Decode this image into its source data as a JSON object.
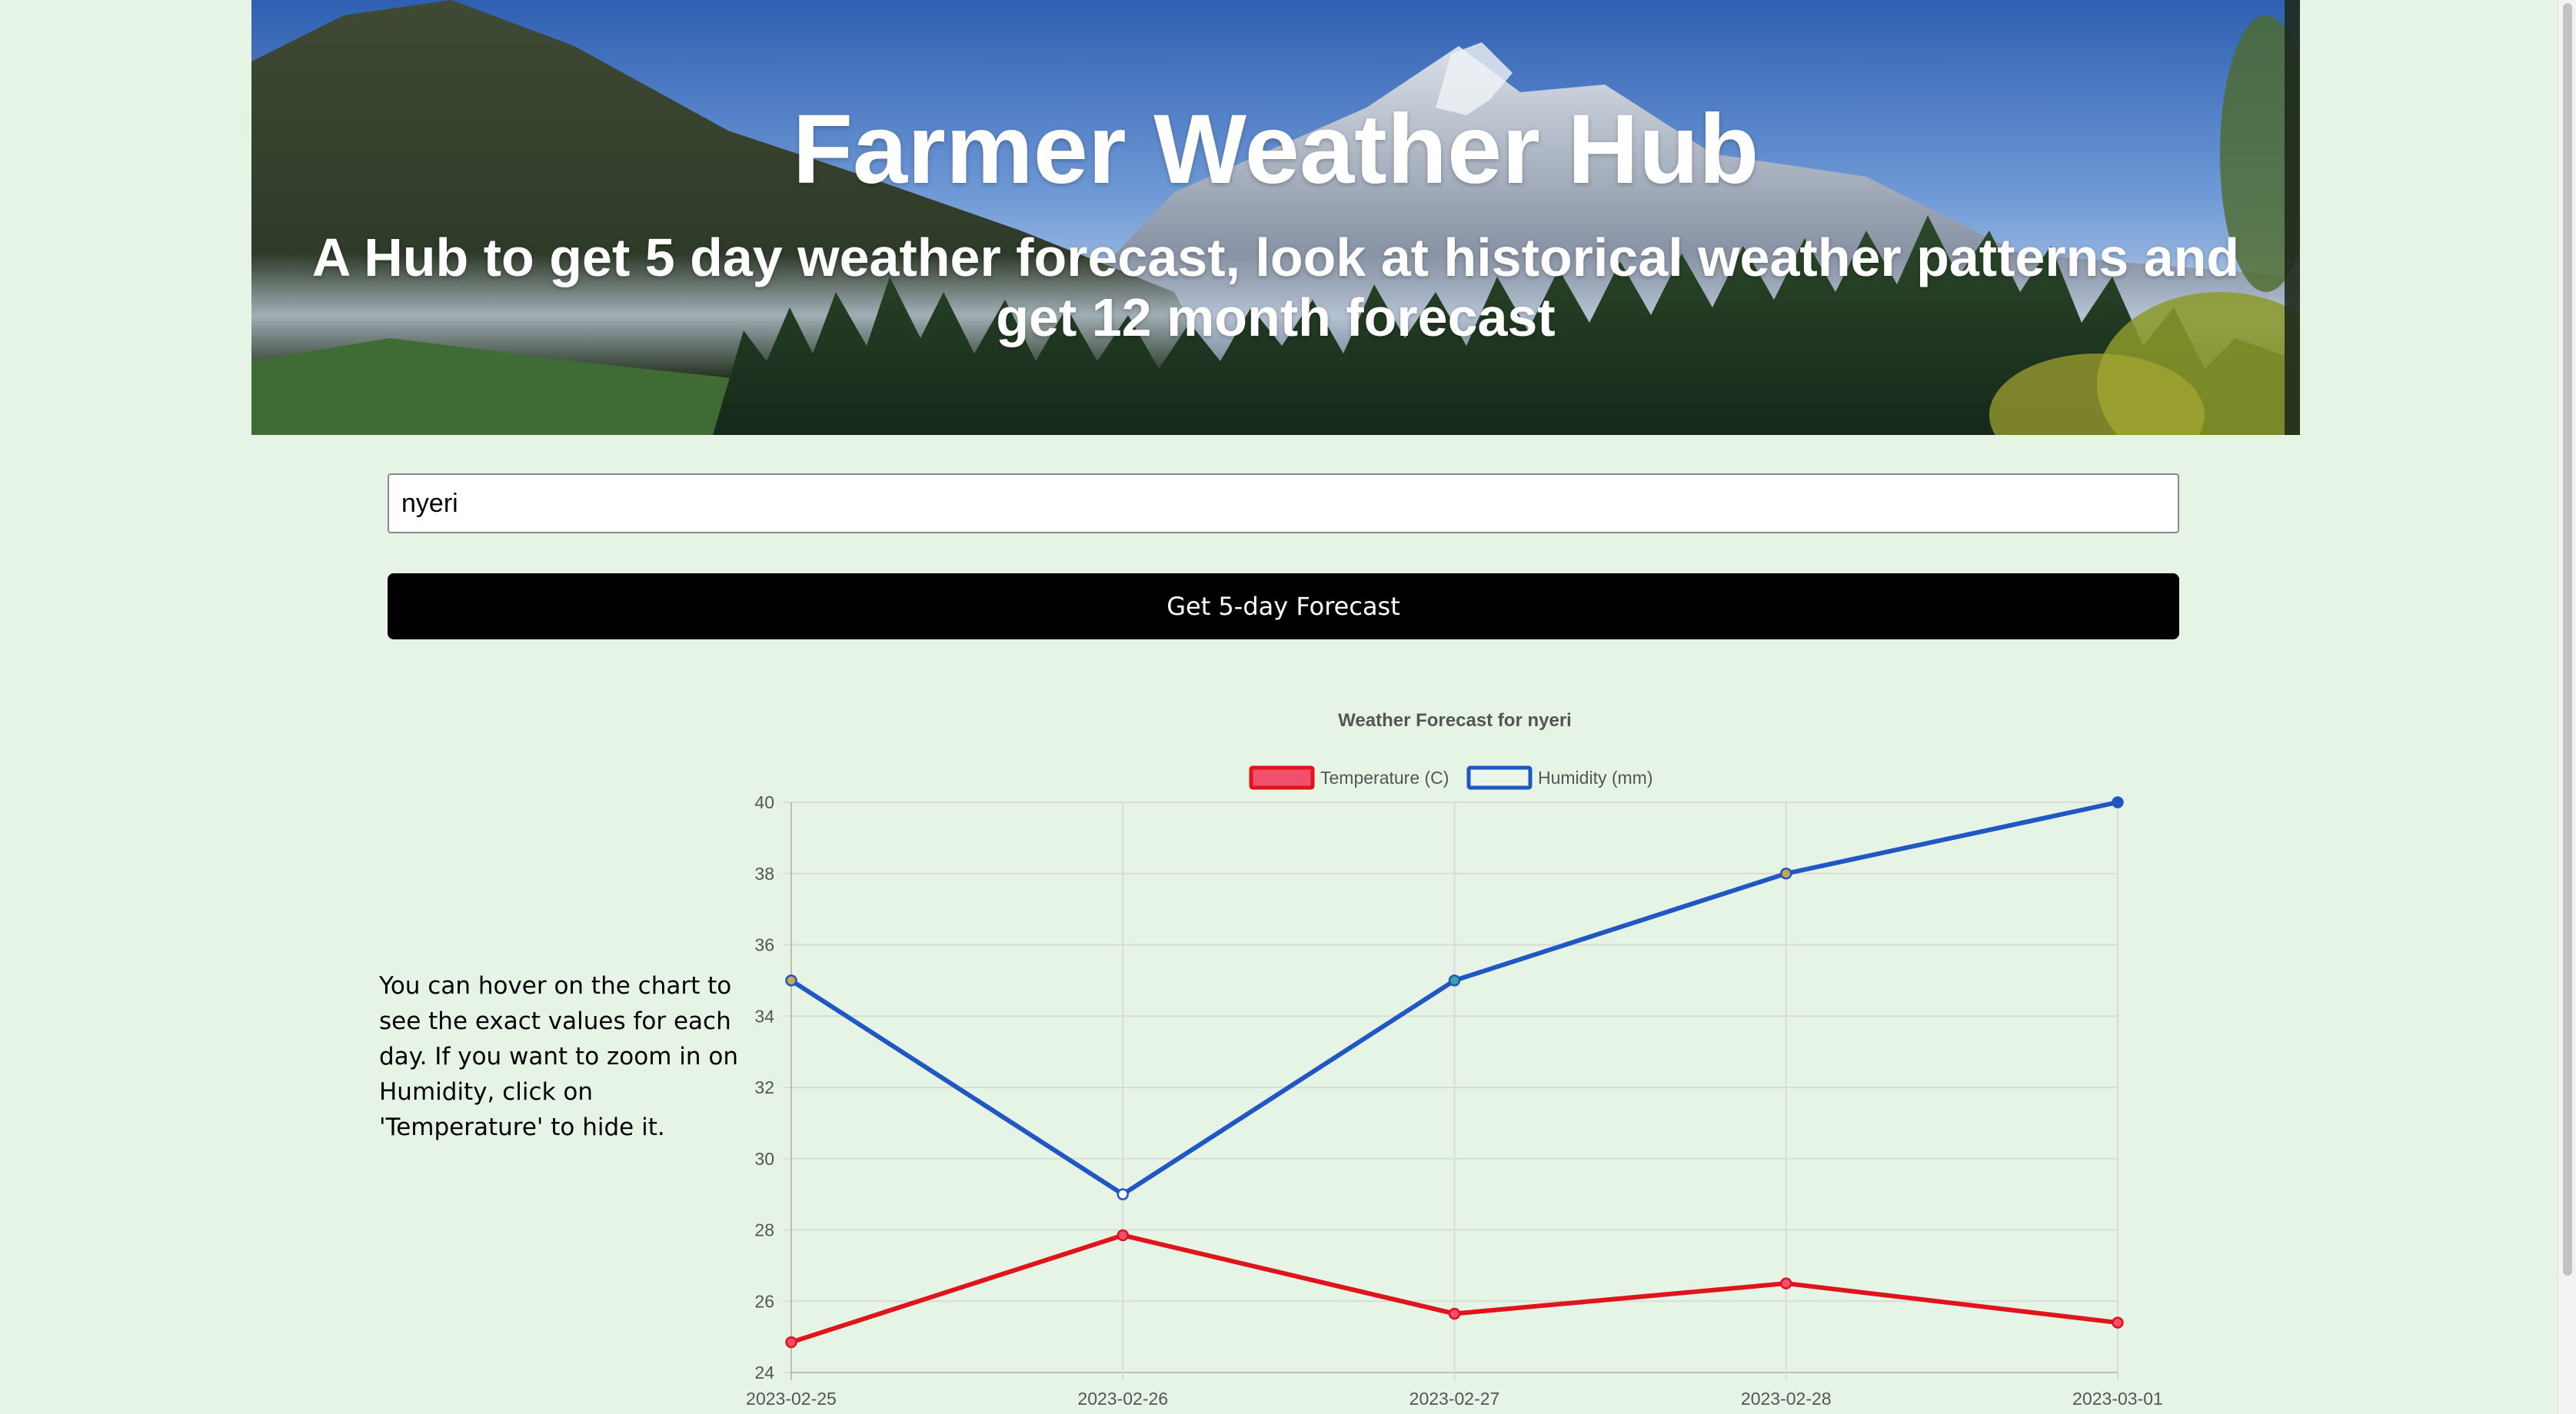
{
  "hero": {
    "title": "Farmer Weather Hub",
    "subtitle": "A Hub to get 5 day weather forecast, look at historical weather patterns and get 12 month forecast"
  },
  "search": {
    "value": "nyeri"
  },
  "forecast_button": {
    "label": "Get 5-day Forecast"
  },
  "hint_text": "You can hover on the chart to see the exact values for each day. If you want to zoom in on Humidity, click on 'Temperature' to hide it.",
  "colors": {
    "page_background": "#e6f4e6",
    "button_background": "#000000",
    "temperature": "#e0151b",
    "temperature_fill": "#f0506e",
    "humidity": "#2157c4"
  },
  "chart_data": {
    "type": "line",
    "title": "Weather Forecast for nyeri",
    "categories": [
      "2023-02-25",
      "2023-02-26",
      "2023-02-27",
      "2023-02-28",
      "2023-03-01"
    ],
    "series": [
      {
        "name": "Temperature (C)",
        "values": [
          24.85,
          27.85,
          25.65,
          26.5,
          25.4
        ]
      },
      {
        "name": "Humidity (mm)",
        "values": [
          35,
          29,
          35,
          38,
          40
        ]
      }
    ],
    "ylim": [
      24,
      40
    ],
    "yticks": [
      24,
      26,
      28,
      30,
      32,
      34,
      36,
      38,
      40
    ],
    "grid": true,
    "legend_position": "top"
  }
}
